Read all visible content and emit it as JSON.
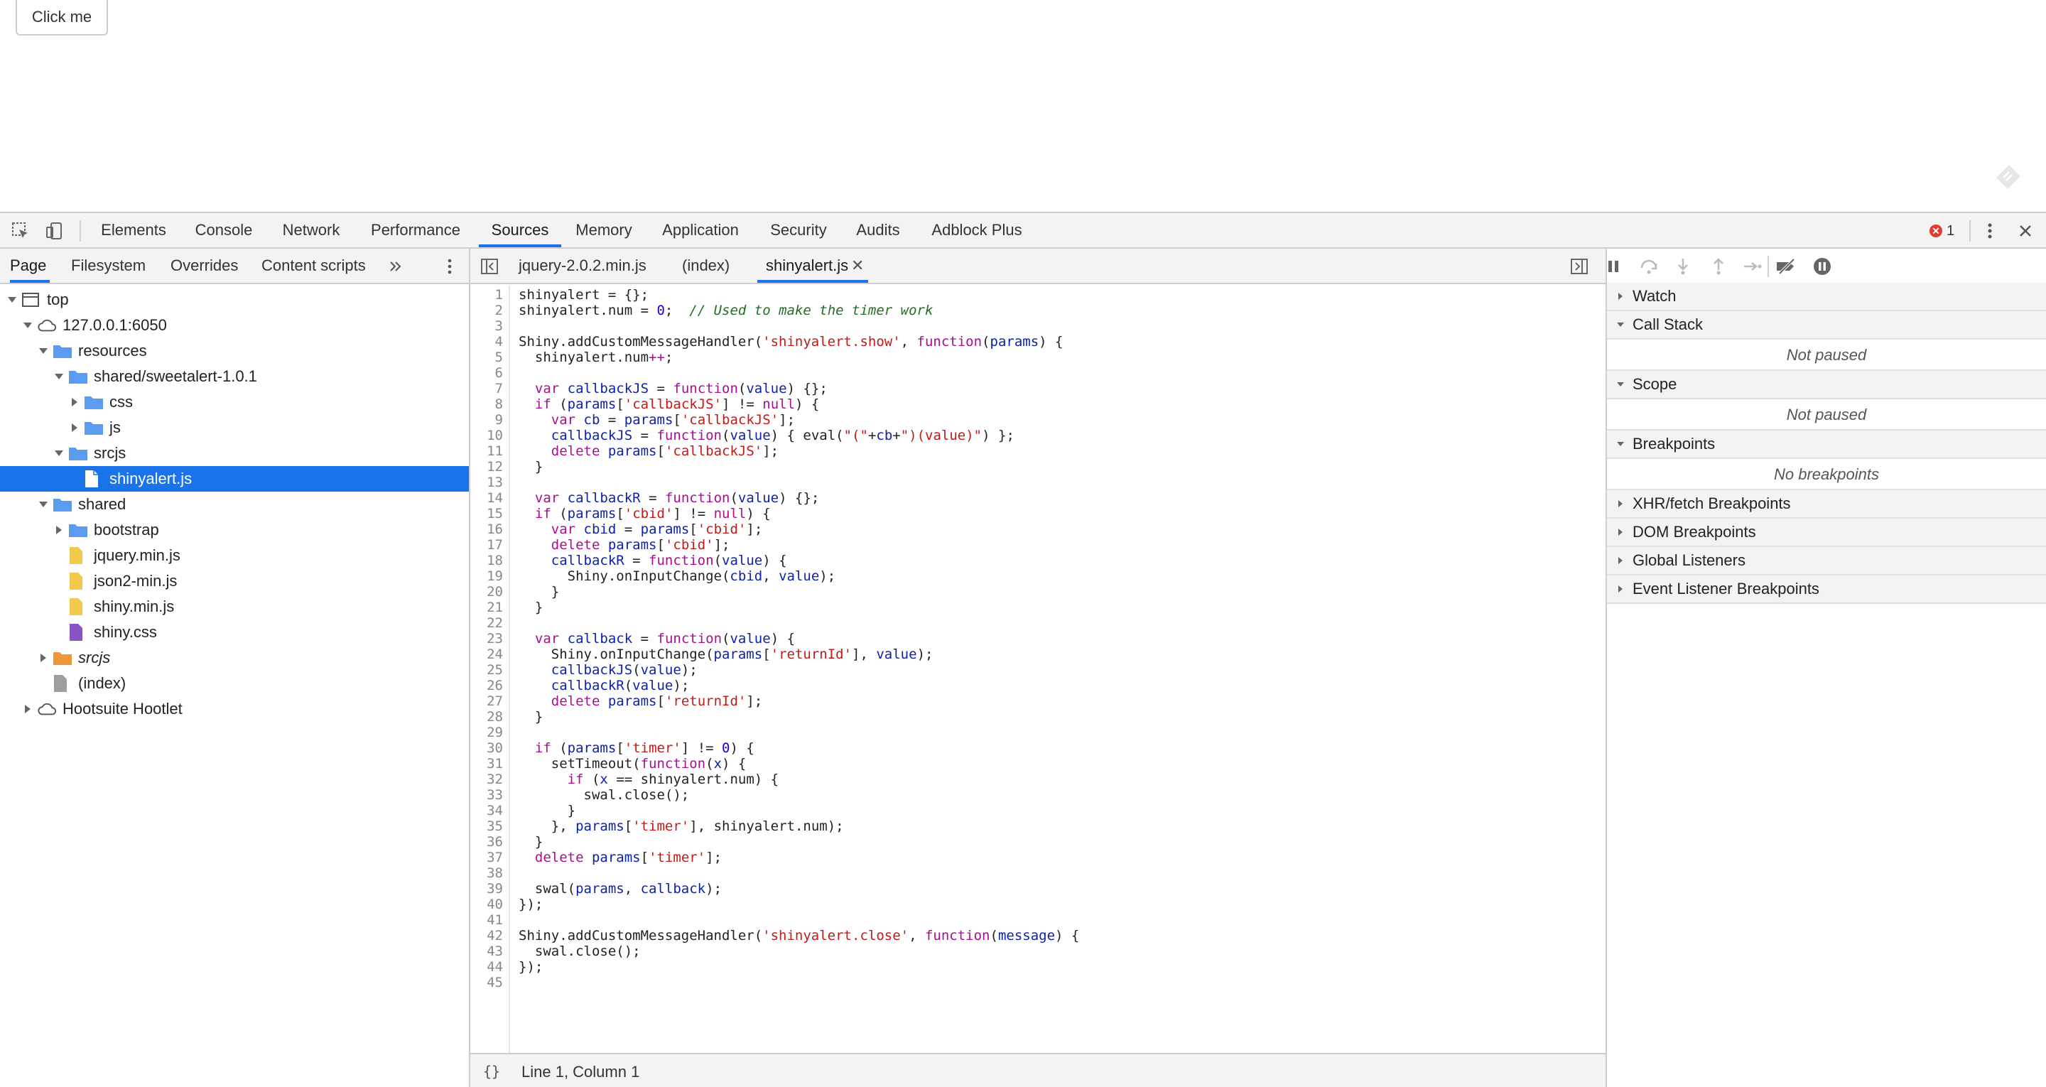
{
  "page": {
    "click_button": "Click me"
  },
  "toolbar": {
    "tabs": [
      "Elements",
      "Console",
      "Network",
      "Performance",
      "Sources",
      "Memory",
      "Application",
      "Security",
      "Audits",
      "Adblock Plus"
    ],
    "error_count": "1"
  },
  "navigator": {
    "tabs": [
      "Page",
      "Filesystem",
      "Overrides",
      "Content scripts"
    ],
    "tree": [
      {
        "label": "top"
      },
      {
        "label": "127.0.0.1:6050"
      },
      {
        "label": "resources"
      },
      {
        "label": "shared/sweetalert-1.0.1"
      },
      {
        "label": "css"
      },
      {
        "label": "js"
      },
      {
        "label": "srcjs"
      },
      {
        "label": "shinyalert.js"
      },
      {
        "label": "shared"
      },
      {
        "label": "bootstrap"
      },
      {
        "label": "jquery.min.js"
      },
      {
        "label": "json2-min.js"
      },
      {
        "label": "shiny.min.js"
      },
      {
        "label": "shiny.css"
      },
      {
        "label": "srcjs"
      },
      {
        "label": "(index)"
      },
      {
        "label": "Hootsuite Hootlet"
      }
    ]
  },
  "editor": {
    "tabs": [
      "jquery-2.0.2.min.js",
      "(index)",
      "shinyalert.js"
    ],
    "status": "Line 1, Column 1",
    "format_label": "{}"
  },
  "debugger": {
    "sections": {
      "watch": "Watch",
      "call_stack": "Call Stack",
      "call_stack_body": "Not paused",
      "scope": "Scope",
      "scope_body": "Not paused",
      "breakpoints": "Breakpoints",
      "breakpoints_body": "No breakpoints",
      "xhr": "XHR/fetch Breakpoints",
      "dom": "DOM Breakpoints",
      "global": "Global Listeners",
      "event": "Event Listener Breakpoints"
    }
  },
  "colors": {
    "accent": "#1a73e8",
    "selected_bg": "#1a73e8",
    "folder": "#5b9bf0",
    "error": "#e63a2e"
  }
}
